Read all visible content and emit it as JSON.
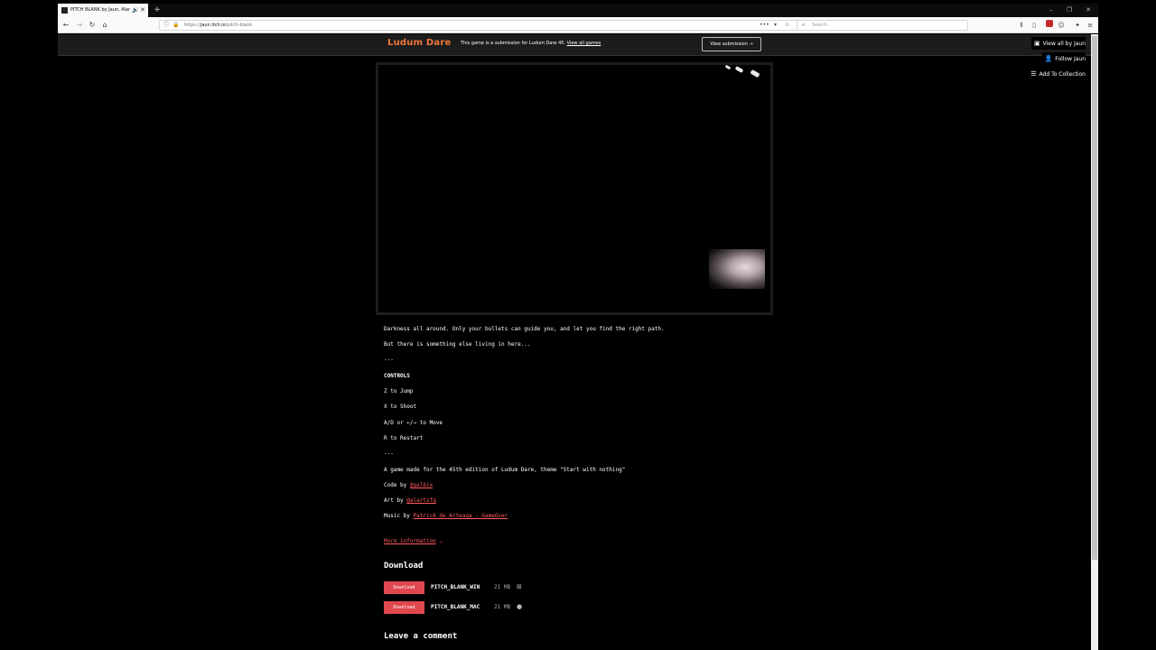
{
  "browser": {
    "tab_title": "PITCH BLANK by Jaun, Alar",
    "url_prefix": "https://",
    "url_host": "jaun.itch.io",
    "url_path": "/pitch-blank",
    "search_placeholder": "Search"
  },
  "jam_bar": {
    "logo": "Ludum Dare",
    "text": "This game is a submission for Ludum Dare 45.",
    "link": "View all games",
    "button": "View submission →"
  },
  "side_actions": {
    "view_all": "View all by Jaun",
    "follow": "Follow Jaun",
    "collection": "Add To Collection"
  },
  "description": {
    "line1": "Darkness all around. Only your bullets can guide you, and let you find the right path.",
    "line2": "But there is something else living in here...",
    "sep1": "---",
    "controls_heading": "CONTROLS",
    "c1": "Z to Jump",
    "c2": "X to Shoot",
    "c3": "A/D or ←/→ to Move",
    "c4": "R to Restart",
    "sep2": "---",
    "about": "A game made for the 45th edition of Ludum Dare, theme \"Start with nothing\"",
    "code_label": "Code by ",
    "code_link": "@galbix",
    "art_label": "Art by ",
    "art_link": "@alartsfg",
    "music_label": "Music by ",
    "music_link": "Patrick de Arteaga - GameOver",
    "more_info": "More information"
  },
  "download": {
    "heading": "Download",
    "files": [
      {
        "button": "Download",
        "name": "PITCH_BLANK_WIN",
        "size": "21 MB",
        "platform_icon": "windows-icon"
      },
      {
        "button": "Download",
        "name": "PITCH_BLANK_MAC",
        "size": "21 MB",
        "platform_icon": "apple-icon"
      }
    ]
  },
  "comments": {
    "heading": "Leave a comment"
  }
}
